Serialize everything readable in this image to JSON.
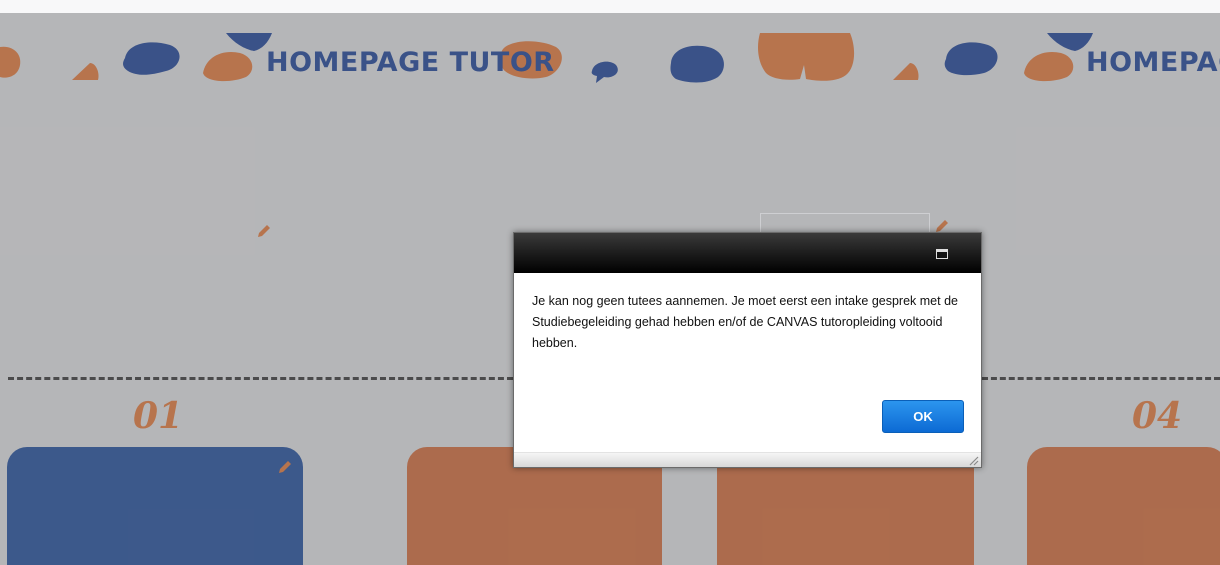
{
  "banner": {
    "text_1": "HOMEPAGE TUTOR",
    "text_2": "HOMEPAGE"
  },
  "steps": {
    "step_1": "01",
    "step_4": "04"
  },
  "dialog": {
    "message": "Je kan nog geen tutees aannemen. Je moet eerst een intake gesprek met de Studiebegeleiding gehad hebben en/of de CANVAS tutoropleiding voltooid hebben.",
    "ok_label": "OK",
    "maximize_icon": "maximize-icon",
    "resize_icon": "resize-grip-icon"
  },
  "colors": {
    "blue": "#2a4a82",
    "orange": "#a95f3c",
    "banner_blue": "#27427f",
    "banner_orange": "#b5693c",
    "ok_button": "#1576dc"
  }
}
